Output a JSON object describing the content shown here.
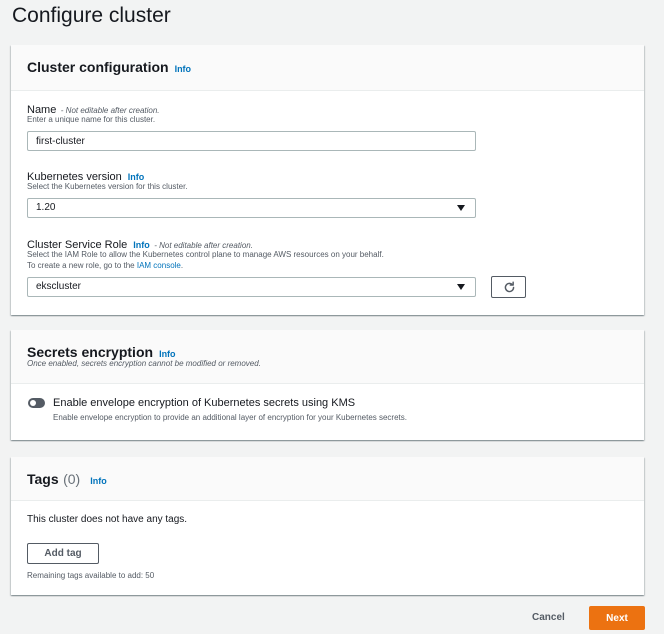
{
  "page": {
    "title": "Configure cluster"
  },
  "cluster_config": {
    "title": "Cluster configuration",
    "info": "Info",
    "name": {
      "label": "Name",
      "note": "- Not editable after creation.",
      "description": "Enter a unique name for this cluster.",
      "value": "first-cluster"
    },
    "version": {
      "label": "Kubernetes version",
      "info": "Info",
      "description": "Select the Kubernetes version for this cluster.",
      "selected": "1.20"
    },
    "role": {
      "label": "Cluster Service Role",
      "info": "Info",
      "note": "- Not editable after creation.",
      "description_1": "Select the IAM Role to allow the Kubernetes control plane to manage AWS resources on your behalf.",
      "description_2_prefix": "To create a new role, go to the",
      "description_2_link": "IAM console",
      "description_2_suffix": ".",
      "selected": "ekscluster"
    }
  },
  "secrets": {
    "title": "Secrets encryption",
    "info": "Info",
    "subtitle": "Once enabled, secrets encryption cannot be modified or removed.",
    "toggle_label": "Enable envelope encryption of Kubernetes secrets using KMS",
    "toggle_description": "Enable envelope encryption to provide an additional layer of encryption for your Kubernetes secrets.",
    "enabled": false
  },
  "tags": {
    "title": "Tags",
    "count": "(0)",
    "info": "Info",
    "empty_text": "This cluster does not have any tags.",
    "add_label": "Add tag",
    "remaining": "Remaining tags available to add: 50"
  },
  "actions": {
    "cancel_label": "Cancel",
    "next_label": "Next"
  },
  "colors": {
    "link": "#0073bb",
    "primary": "#ec7211",
    "background": "#f2f3f3"
  }
}
